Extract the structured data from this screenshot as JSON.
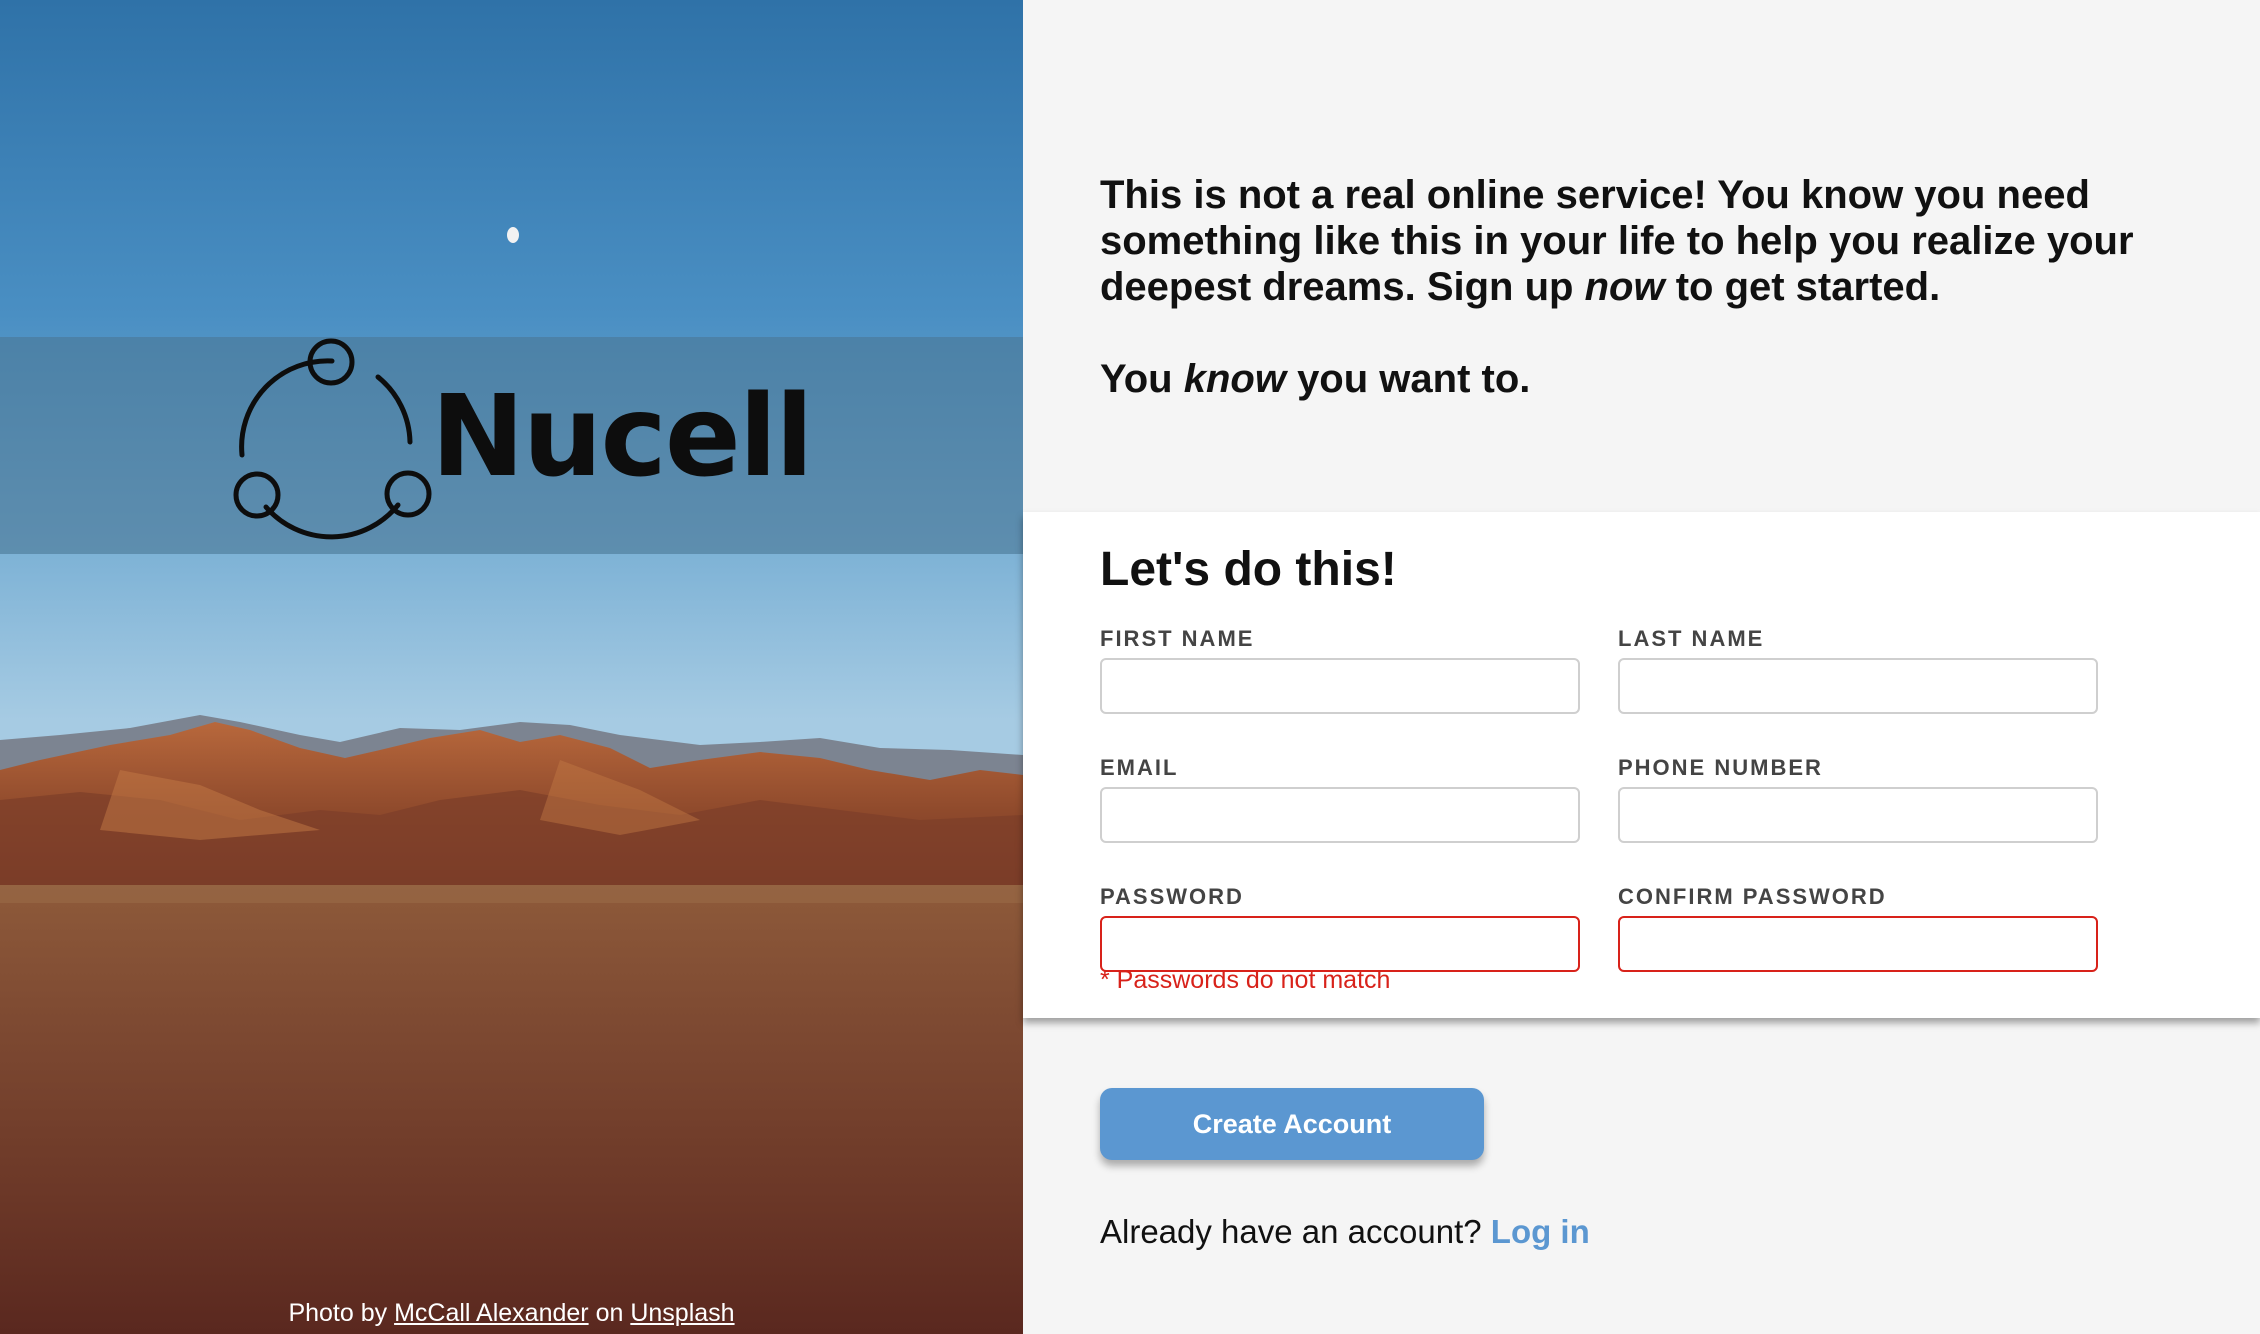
{
  "brand": {
    "name": "Nucell",
    "logo_icon": "connected-nodes-icon"
  },
  "hero": {
    "credit_prefix": "Photo by",
    "photographer": "McCall Alexander",
    "credit_middle": "on",
    "source": "Unsplash"
  },
  "intro": {
    "line1_pre": "This is not a real online service! You know you need something like this in your life to help you realize your deepest dreams. Sign up",
    "line1_em": "now",
    "line1_post": "to get started.",
    "line2_pre": "You",
    "line2_em": "know",
    "line2_post": "you want to."
  },
  "form": {
    "title": "Let's do this!",
    "fields": {
      "first_name": {
        "label": "First Name",
        "value": ""
      },
      "last_name": {
        "label": "Last Name",
        "value": ""
      },
      "email": {
        "label": "Email",
        "value": ""
      },
      "phone": {
        "label": "Phone Number",
        "value": ""
      },
      "password": {
        "label": "Password",
        "value": ""
      },
      "confirm_password": {
        "label": "Confirm Password",
        "value": ""
      }
    },
    "error": "* Passwords do not match"
  },
  "actions": {
    "submit_label": "Create Account",
    "login_prompt": "Already have an account?",
    "login_link": "Log in"
  },
  "colors": {
    "accent": "#5b97d1",
    "error": "#d8221a",
    "panel_bg": "#f5f5f5"
  }
}
